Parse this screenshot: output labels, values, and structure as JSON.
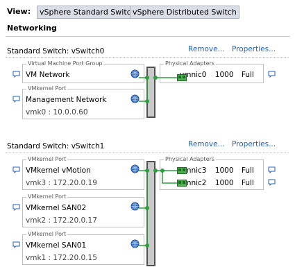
{
  "view": {
    "label": "View:",
    "buttons": [
      "vSphere Standard Switch",
      "vSphere Distributed Switch"
    ]
  },
  "section_title": "Networking",
  "switches": [
    {
      "title": "Standard Switch: vSwitch0",
      "remove_label": "Remove...",
      "properties_label": "Properties...",
      "port_groups": [
        {
          "type": "Virtual Machine Port Group",
          "name": "VM Network",
          "sub": ""
        },
        {
          "type": "VMkernel Port",
          "name": "Management Network",
          "sub": "vmk0 : 10.0.0.60"
        }
      ],
      "adapters_title": "Physical Adapters",
      "adapters": [
        {
          "name": "vmnic0",
          "speed": "1000",
          "duplex": "Full"
        }
      ]
    },
    {
      "title": "Standard Switch: vSwitch1",
      "remove_label": "Remove...",
      "properties_label": "Properties...",
      "port_groups": [
        {
          "type": "VMkernel Port",
          "name": "VMkernel vMotion",
          "sub": "vmk3 : 172.20.0.19"
        },
        {
          "type": "VMkernel Port",
          "name": "VMkernel SAN02",
          "sub": "vmk2 : 172.20.0.17"
        },
        {
          "type": "VMkernel Port",
          "name": "VMkernel SAN01",
          "sub": "vmk1 : 172.20.0.15"
        }
      ],
      "adapters_title": "Physical Adapters",
      "adapters": [
        {
          "name": "vmnic3",
          "speed": "1000",
          "duplex": "Full"
        },
        {
          "name": "vmnic2",
          "speed": "1000",
          "duplex": "Full"
        }
      ]
    }
  ],
  "icons": {
    "comment": "speech-bubble-icon",
    "globe": "port-group-globe-icon",
    "nic": "network-adapter-icon"
  },
  "colors": {
    "link": "#1f5fbf",
    "connector": "#2e9e3e",
    "bar_fill": "#c9c9c9",
    "bar_border": "#4f4f4f"
  }
}
